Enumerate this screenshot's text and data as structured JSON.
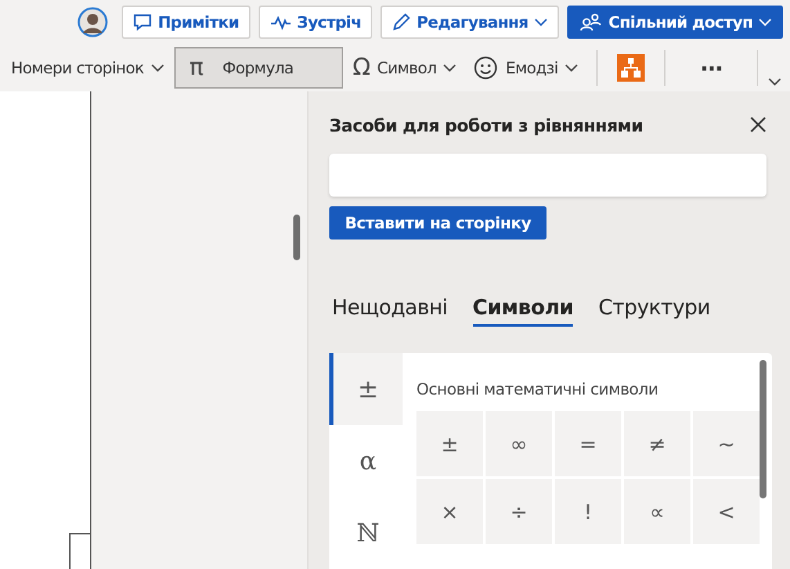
{
  "header_buttons": [
    {
      "label": "Примітки",
      "kind": "comments",
      "primary": false,
      "dropdown": false
    },
    {
      "label": "Зустріч",
      "kind": "meet",
      "primary": false,
      "dropdown": false
    },
    {
      "label": "Редагування",
      "kind": "edit",
      "primary": false,
      "dropdown": true
    },
    {
      "label": "Спільний доступ",
      "kind": "share",
      "primary": true,
      "dropdown": true
    }
  ],
  "ribbon": [
    {
      "kind": "menu",
      "label": "Номери сторінок",
      "dropdown": true,
      "selected": false
    },
    {
      "kind": "glyph",
      "glyph": "π",
      "label": "Формула",
      "dropdown": false,
      "selected": true
    },
    {
      "kind": "glyph",
      "glyph": "Ω",
      "label": "Символ",
      "dropdown": true,
      "selected": false
    },
    {
      "kind": "emoji",
      "label": "Емодзі",
      "dropdown": true,
      "selected": false
    },
    {
      "kind": "addin"
    },
    {
      "kind": "more",
      "glyph": "⋯"
    }
  ],
  "panel": {
    "title": "Засоби для роботи з рівняннями",
    "insert_button": "Вставити на сторінку",
    "tabs": [
      {
        "label": "Нещодавні",
        "selected": false
      },
      {
        "label": "Символи",
        "selected": true
      },
      {
        "label": "Структури",
        "selected": false
      }
    ],
    "categories": [
      {
        "glyph": "±",
        "selected": true
      },
      {
        "glyph": "α",
        "selected": false
      },
      {
        "glyph": "ℕ",
        "selected": false
      }
    ],
    "group_title": "Основні математичні символи",
    "symbols": [
      "±",
      "∞",
      "=",
      "≠",
      "~",
      "×",
      "÷",
      "!",
      "∝",
      "<"
    ]
  }
}
